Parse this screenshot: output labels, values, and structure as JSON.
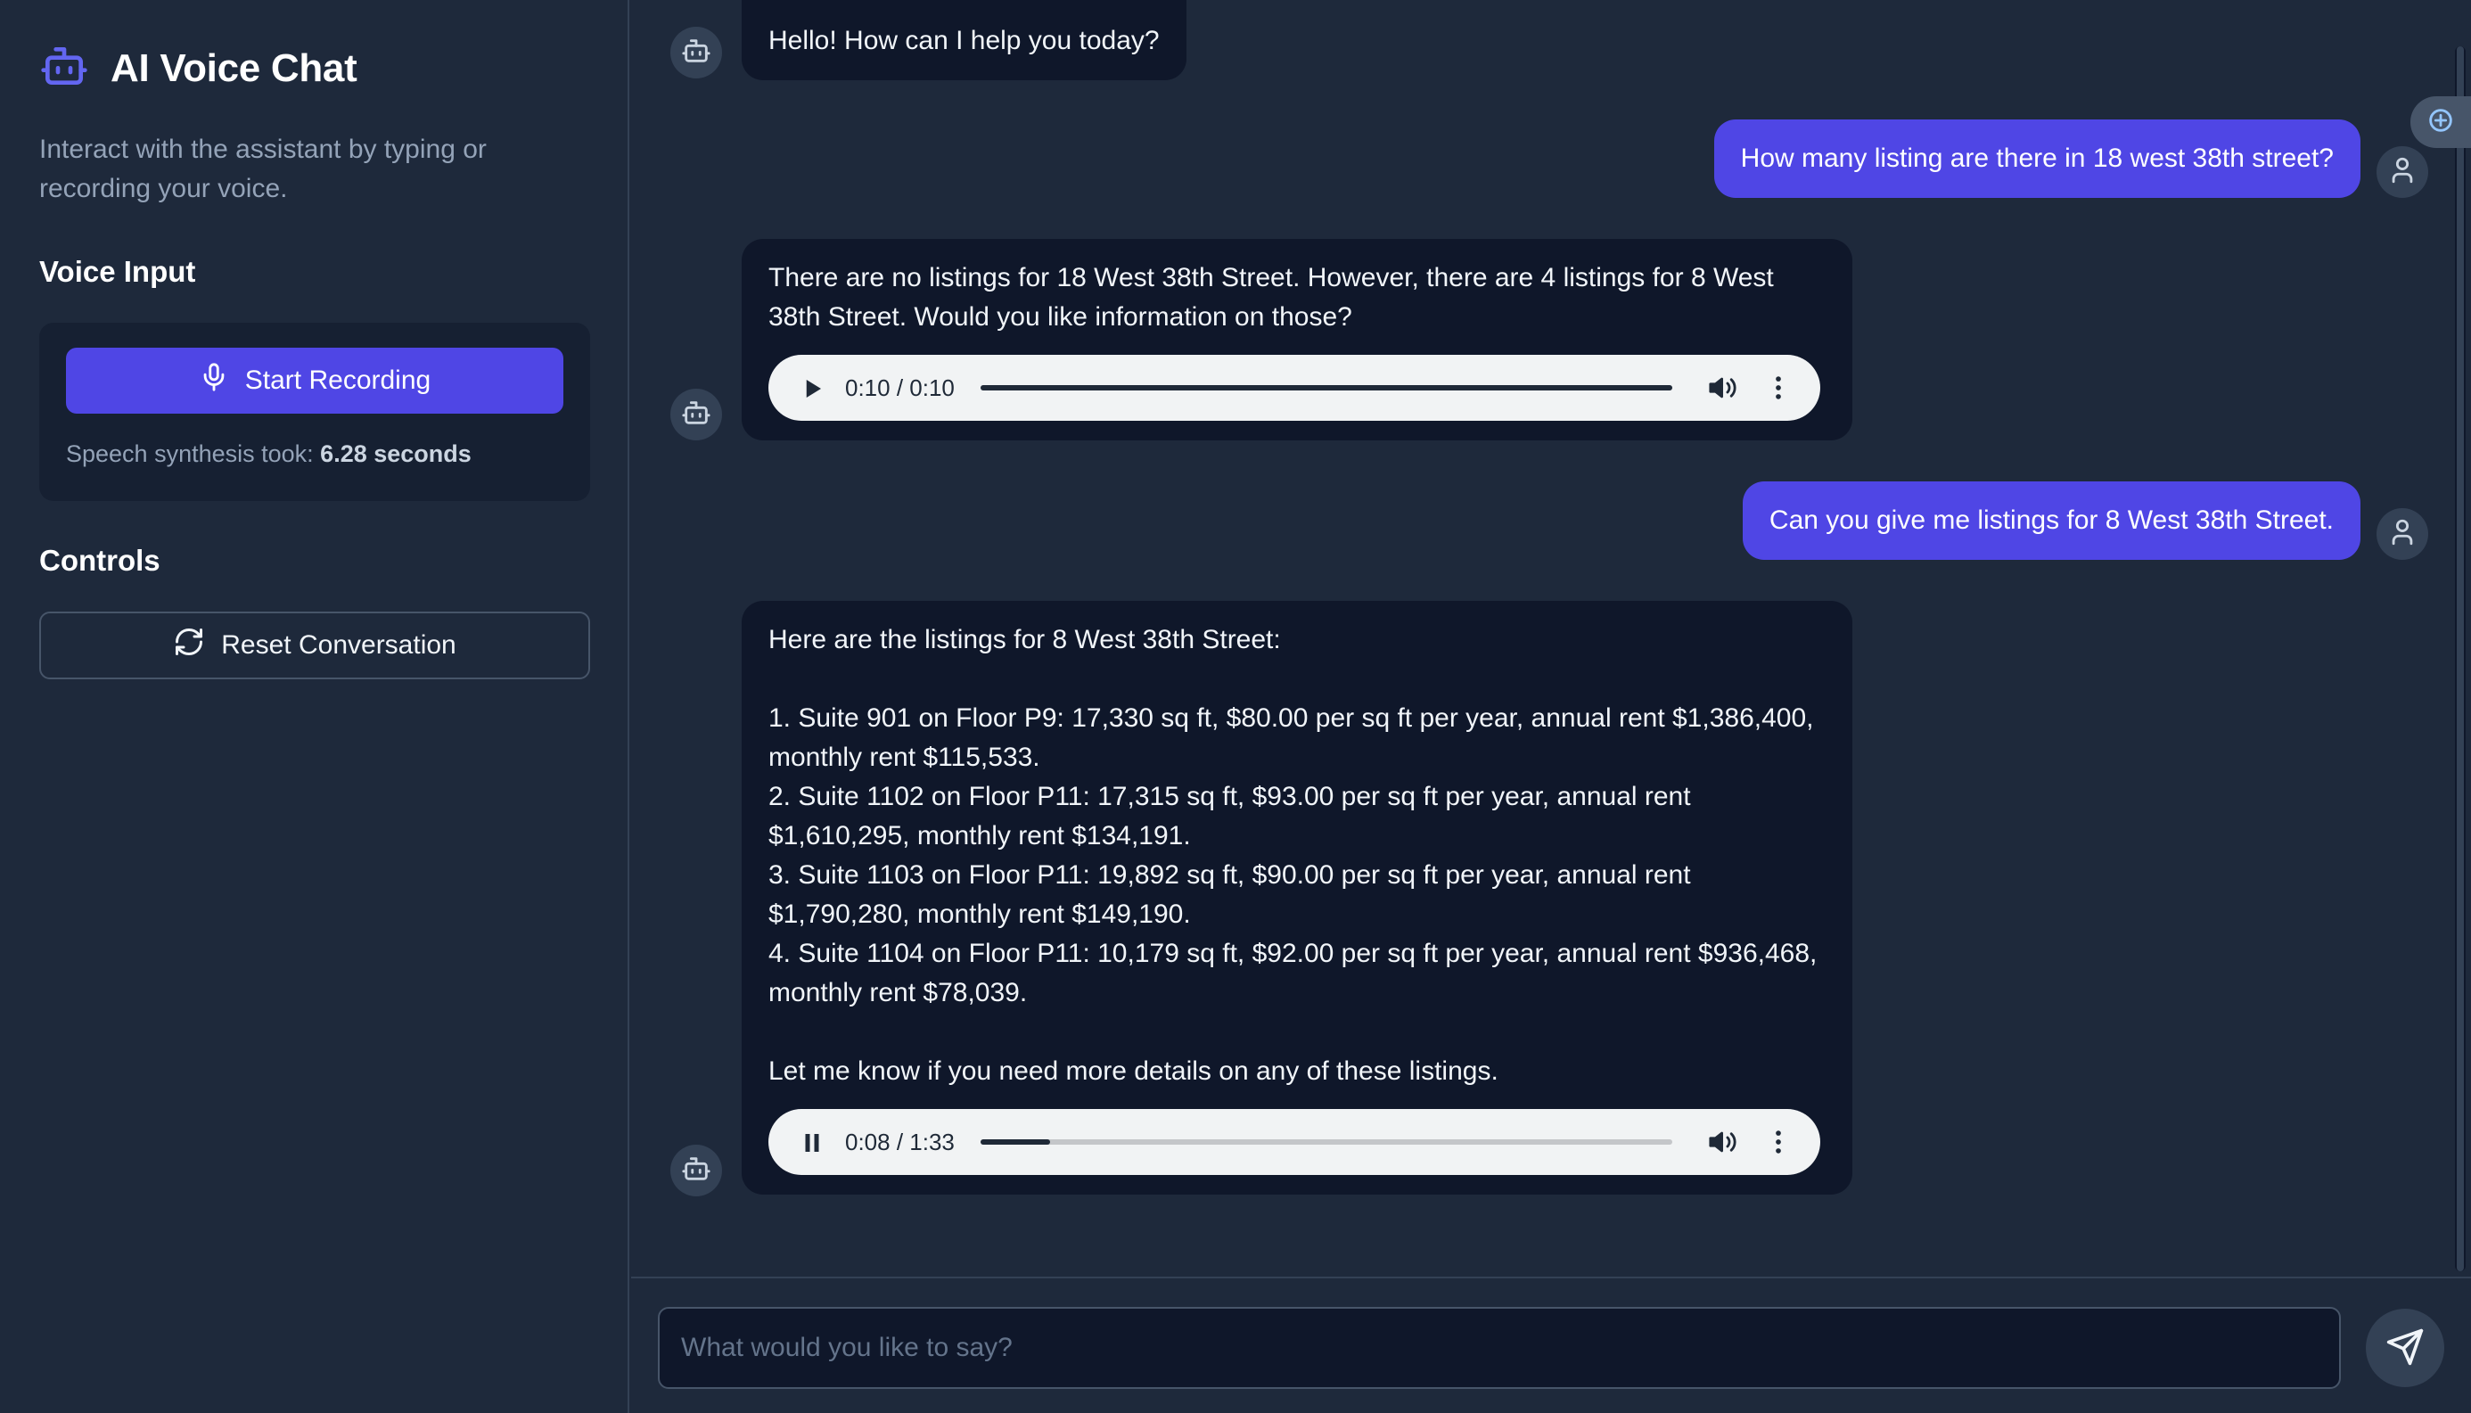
{
  "app": {
    "title": "AI Voice Chat",
    "subtitle": "Interact with the assistant by typing or recording your voice."
  },
  "sidebar": {
    "voice_input_heading": "Voice Input",
    "record_button_label": "Start Recording",
    "synthesis_label": "Speech synthesis took: ",
    "synthesis_value": "6.28 seconds",
    "controls_heading": "Controls",
    "reset_button_label": "Reset Conversation"
  },
  "messages": [
    {
      "role": "assistant",
      "text": "Hello! How can I help you today?"
    },
    {
      "role": "user",
      "text": "How many listing are there in 18 west 38th street?"
    },
    {
      "role": "assistant",
      "text": "There are no listings for 18 West 38th Street. However, there are 4 listings for 8 West 38th Street. Would you like information on those?",
      "audio": {
        "state": "paused",
        "time": "0:10 / 0:10",
        "progress": 1.0
      }
    },
    {
      "role": "user",
      "text": "Can you give me listings for 8 West 38th Street."
    },
    {
      "role": "assistant",
      "lines": [
        "Here are the listings for 8 West 38th Street:",
        "",
        "1. Suite 901 on Floor P9: 17,330 sq ft, $80.00 per sq ft per year, annual rent $1,386,400, monthly rent $115,533.",
        "2. Suite 1102 on Floor P11: 17,315 sq ft, $93.00 per sq ft per year, annual rent $1,610,295, monthly rent $134,191.",
        "3. Suite 1103 on Floor P11: 19,892 sq ft, $90.00 per sq ft per year, annual rent $1,790,280, monthly rent $149,190.",
        "4. Suite 1104 on Floor P11: 10,179 sq ft, $92.00 per sq ft per year, annual rent $936,468, monthly rent $78,039.",
        "",
        "Let me know if you need more details on any of these listings."
      ],
      "audio": {
        "state": "playing",
        "time": "0:08 / 1:33",
        "progress": 0.1
      }
    }
  ],
  "composer": {
    "placeholder": "What would you like to say?",
    "value": ""
  },
  "icons": {
    "brand": "robot-icon",
    "record": "microphone-icon",
    "reset": "refresh-icon",
    "assistant_avatar": "robot-icon",
    "user_avatar": "user-icon",
    "send": "send-icon"
  },
  "colors": {
    "accent": "#4f46e5",
    "background": "#1e293b",
    "bubble_assistant": "#0f172a",
    "bubble_user": "#4f46e5"
  }
}
